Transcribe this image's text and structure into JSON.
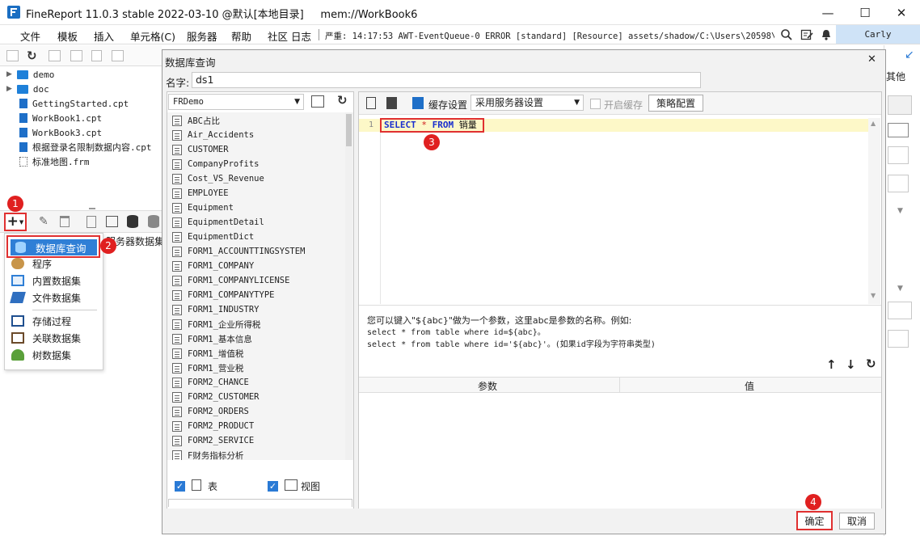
{
  "window": {
    "title": "FineReport 11.0.3 stable 2022-03-10 @默认[本地目录]     mem://WorkBook6",
    "minimize": "—",
    "maximize": "☐",
    "close": "✕"
  },
  "menubar": {
    "items": [
      "文件",
      "模板",
      "插入",
      "单元格(C)",
      "服务器",
      "帮助",
      "社区",
      "日志"
    ],
    "status": "严重: 14:17:53 AWT-EventQueue-0 ERROR [standard] [Resource] assets/shadow/C:\\Users\\20598\\De...",
    "user": "Carly"
  },
  "filetree": {
    "items": [
      {
        "name": "demo",
        "type": "folder"
      },
      {
        "name": "doc",
        "type": "folder"
      },
      {
        "name": "GettingStarted.cpt",
        "type": "cpt"
      },
      {
        "name": "WorkBook1.cpt",
        "type": "cpt"
      },
      {
        "name": "WorkBook3.cpt",
        "type": "cpt"
      },
      {
        "name": "根据登录名限制数据内容.cpt",
        "type": "cpt"
      },
      {
        "name": "标准地图.frm",
        "type": "frm"
      }
    ]
  },
  "datasetpanel": {
    "server_tab": "服务器数据集"
  },
  "popup": {
    "items": [
      {
        "label": "数据库查询",
        "icon": "database-icon"
      },
      {
        "label": "程序",
        "icon": "procedure-icon"
      },
      {
        "label": "内置数据集",
        "icon": "builtin-dataset-icon"
      },
      {
        "label": "文件数据集",
        "icon": "file-dataset-icon"
      },
      {
        "label": "存储过程",
        "icon": "stored-procedure-icon"
      },
      {
        "label": "关联数据集",
        "icon": "relation-dataset-icon"
      },
      {
        "label": "树数据集",
        "icon": "tree-dataset-icon"
      }
    ]
  },
  "badges": {
    "b1": "1",
    "b2": "2",
    "b3": "3",
    "b4": "4"
  },
  "rightstrip": {
    "other": "其他"
  },
  "dialog": {
    "title": "数据库查询",
    "close": "✕",
    "name_label": "名字:",
    "name_value": "ds1",
    "connection": "FRDemo",
    "tables": [
      "ABC占比",
      "Air_Accidents",
      "CUSTOMER",
      "CompanyProfits",
      "Cost_VS_Revenue",
      "EMPLOYEE",
      "Equipment",
      "EquipmentDetail",
      "EquipmentDict",
      "FORM1_ACCOUNTTINGSYSTEM",
      "FORM1_COMPANY",
      "FORM1_COMPANYLICENSE",
      "FORM1_COMPANYTYPE",
      "FORM1_INDUSTRY",
      "FORM1_企业所得税",
      "FORM1_基本信息",
      "FORM1_增值税",
      "FORM1_营业税",
      "FORM2_CHANCE",
      "FORM2_CUSTOMER",
      "FORM2_ORDERS",
      "FORM2_PRODUCT",
      "FORM2_SERVICE",
      "F财务指标分析"
    ],
    "filter_table": "表",
    "filter_view": "视图",
    "cache_label": "缓存设置",
    "cache_option": "采用服务器设置",
    "enable_cache": "开启缓存",
    "strategy_button": "策略配置",
    "sql": {
      "line": "1",
      "kw1": "SELECT",
      "star": "*",
      "kw2": "FROM",
      "table": "销量"
    },
    "hint": [
      "您可以键入\"${abc}\"做为一个参数，这里abc是参数的名称。例如:",
      "select * from table where id=${abc}。",
      "select * from table where id='${abc}'。(如果id字段为字符串类型)"
    ],
    "param_col": "参数",
    "value_col": "值",
    "ok": "确定",
    "cancel": "取消"
  }
}
